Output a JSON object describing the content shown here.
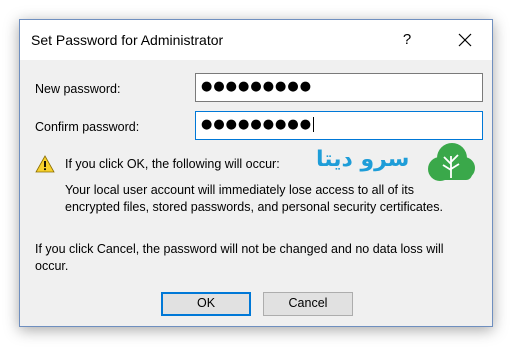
{
  "window": {
    "title": "Set Password for Administrator",
    "help_label": "?"
  },
  "form": {
    "new_password_label": "New password:",
    "new_password_value": "●●●●●●●●●",
    "confirm_password_label": "Confirm password:",
    "confirm_password_value": "●●●●●●●●●"
  },
  "warning": {
    "heading": "If you click OK, the following will occur:",
    "body_line1": "Your local user account will immediately lose access to all of its",
    "body_line2": "encrypted files, stored passwords, and personal security certificates."
  },
  "cancel_info": {
    "line1": "If you click Cancel, the password will not be changed and no data loss will",
    "line2": "occur."
  },
  "buttons": {
    "ok_label": "OK",
    "cancel_label": "Cancel"
  },
  "watermark": {
    "text": "سرو دیتا"
  },
  "colors": {
    "accent": "#0078d7",
    "logo": "#1e9dd8"
  }
}
